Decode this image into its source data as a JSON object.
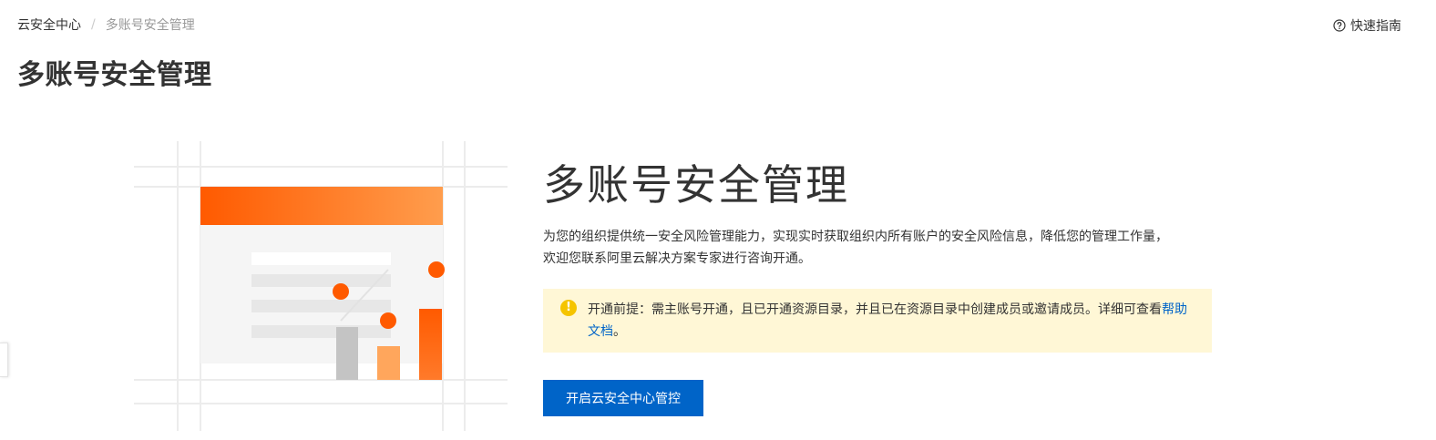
{
  "breadcrumb": {
    "root": "云安全中心",
    "separator": "/",
    "current": "多账号安全管理"
  },
  "header": {
    "quick_guide_label": "快速指南",
    "quick_guide_icon": "help-circle-icon"
  },
  "page": {
    "title": "多账号安全管理"
  },
  "intro": {
    "title": "多账号安全管理",
    "description_line1": "为您的组织提供统一安全风险管理能力，实现实时获取组织内所有账户的安全风险信息，降低您的管理工作量，",
    "description_line2": "欢迎您联系阿里云解决方案专家进行咨询开通。"
  },
  "notice": {
    "icon": "warning-icon",
    "icon_glyph": "!",
    "text_before_link": "开通前提：需主账号开通，且已开通资源目录，并且已在资源目录中创建成员或邀请成员。详细可查看",
    "link_label": "帮助文档",
    "text_after_link": "。"
  },
  "actions": {
    "enable_label": "开启云安全中心管控"
  },
  "colors": {
    "primary": "#0064c8",
    "accent_orange": "#ff5a00",
    "notice_bg": "#fff7d6",
    "warning_yellow": "#f5c400"
  }
}
